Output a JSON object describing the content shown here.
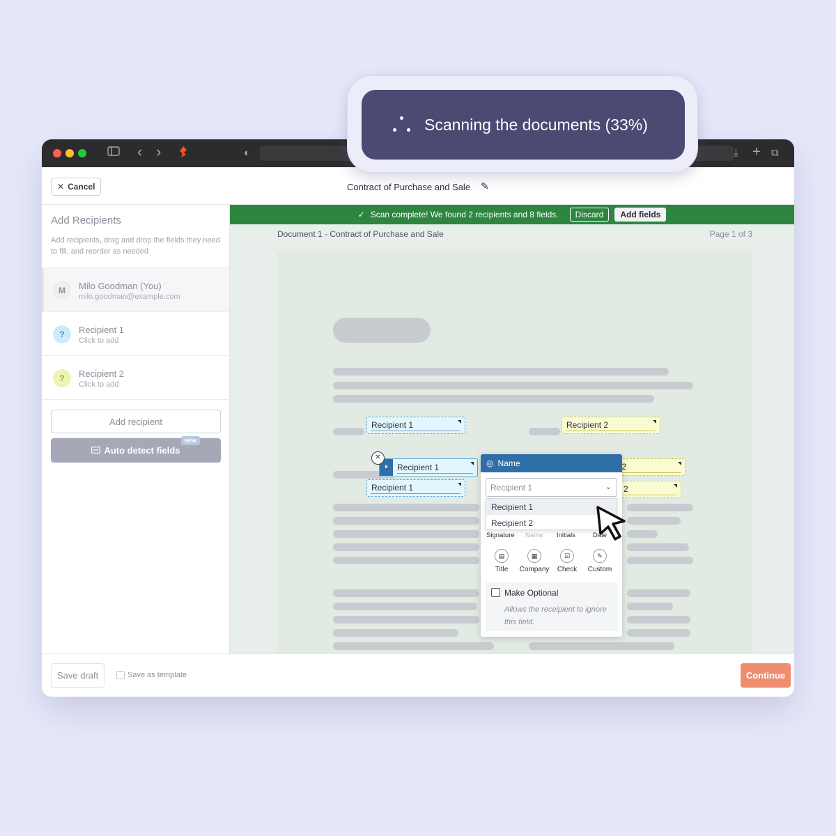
{
  "toast": {
    "text": "Scanning the documents (33%)",
    "progress_percent": 33
  },
  "titlebar": {
    "sidebar_icon": "sidebar-icon",
    "back_icon": "‹",
    "forward_icon": "›",
    "shield_icon": "◐",
    "download_icon": "⤓",
    "new_tab_icon": "+",
    "tabs_icon": "⧉"
  },
  "topbar": {
    "cancel_label": "Cancel",
    "document_title": "Contract of Purchase and Sale"
  },
  "sidebar": {
    "title": "Add Recipients",
    "description": "Add recipients, drag and drop the fields they need to fill, and reorder as needed",
    "recipients": [
      {
        "initial": "M",
        "name": "Milo Goodman (You)",
        "sub": "milo.goodman@example.com",
        "color": "#eeeeef"
      },
      {
        "initial": "?",
        "name": "Recipient 1",
        "sub": "Click to add",
        "color": "#c9ecfb"
      },
      {
        "initial": "?",
        "name": "Recipient 2",
        "sub": "Click to add",
        "color": "#eef3b4"
      }
    ],
    "add_recipient_label": "Add recipient",
    "auto_detect_label": "Auto detect fields",
    "new_badge": "NEW"
  },
  "banner": {
    "message": "Scan complete! We found 2 recipients and 8 fields.",
    "discard_label": "Discard",
    "add_fields_label": "Add fields",
    "color": "#2e8540"
  },
  "document": {
    "label": "Document 1 - Contract of Purchase and Sale",
    "page": "Page 1 of 3",
    "fields": {
      "f1": "Recipient 1",
      "f2": "Recipient 2",
      "f3": "Recipient 1",
      "f4": "Recipient 1",
      "f5": "nt 2",
      "f6": "2"
    }
  },
  "popover": {
    "header": "Name",
    "select_value": "Recipient 1",
    "options": [
      "Recipient 1",
      "Recipient 2"
    ],
    "labels": [
      "Signature",
      "Name",
      "Initials",
      "Date"
    ],
    "tools": [
      {
        "label": "Title",
        "icon": "title-icon"
      },
      {
        "label": "Company",
        "icon": "company-icon"
      },
      {
        "label": "Check",
        "icon": "check-icon"
      },
      {
        "label": "Custom",
        "icon": "pencil-icon"
      }
    ],
    "optional_label": "Make Optional",
    "optional_desc": "Allows the receipient to ignore this field."
  },
  "bottombar": {
    "save_draft_label": "Save draft",
    "template_label": "Save as template",
    "continue_label": "Continue",
    "continue_color": "#ef8d70"
  }
}
